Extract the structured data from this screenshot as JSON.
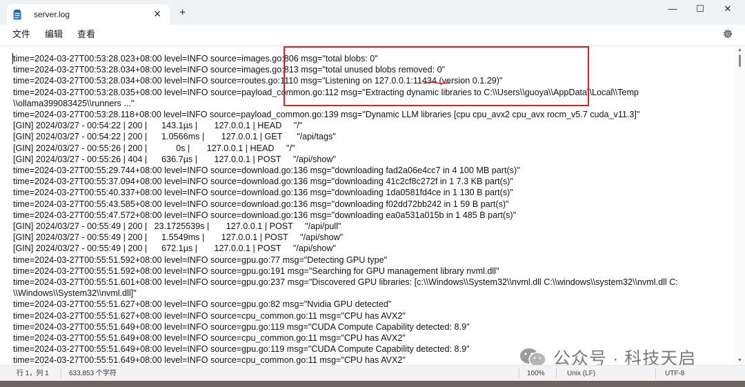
{
  "window": {
    "tab_title": "server.log",
    "tab_close": "✕",
    "new_tab": "+",
    "minimize": "—",
    "maximize": "☐",
    "close": "✕"
  },
  "menu": {
    "file": "文件",
    "edit": "编辑",
    "view": "查看"
  },
  "log_lines": [
    "time=2024-03-27T00:53:28.023+08:00 level=INFO source=images.go:806 msg=\"total blobs: 0\"",
    "time=2024-03-27T00:53:28.034+08:00 level=INFO source=images.go:813 msg=\"total unused blobs removed: 0\"",
    "time=2024-03-27T00:53:28.034+08:00 level=INFO source=routes.go:1110 msg=\"Listening on 127.0.0.1:11434 (version 0.1.29)\"",
    "time=2024-03-27T00:53:28.035+08:00 level=INFO source=payload_common.go:112 msg=\"Extracting dynamic libraries to C:\\\\Users\\\\guoya\\\\AppData\\\\Local\\\\Temp",
    "\\\\ollama399083425\\\\runners ...\"",
    "time=2024-03-27T00:53:28.118+08:00 level=INFO source=payload_common.go:139 msg=\"Dynamic LLM libraries [cpu cpu_avx2 cpu_avx rocm_v5.7 cuda_v11.3]\"",
    "[GIN] 2024/03/27 - 00:54:22 | 200 |      143.1µs |       127.0.0.1 | HEAD     \"/\"",
    "[GIN] 2024/03/27 - 00:54:22 | 200 |      1.0566ms |       127.0.0.1 | GET      \"/api/tags\"",
    "[GIN] 2024/03/27 - 00:55:26 | 200 |            0s |       127.0.0.1 | HEAD     \"/\"",
    "[GIN] 2024/03/27 - 00:55:26 | 404 |      636.7µs |       127.0.0.1 | POST     \"/api/show\"",
    "time=2024-03-27T00:55:29.744+08:00 level=INFO source=download.go:136 msg=\"downloading fad2a06e4cc7 in 4 100 MB part(s)\"",
    "time=2024-03-27T00:55:37.094+08:00 level=INFO source=download.go:136 msg=\"downloading 41c2cf8c272f in 1 7.3 KB part(s)\"",
    "time=2024-03-27T00:55:40.337+08:00 level=INFO source=download.go:136 msg=\"downloading 1da0581fd4ce in 1 130 B part(s)\"",
    "time=2024-03-27T00:55:43.585+08:00 level=INFO source=download.go:136 msg=\"downloading f02dd72bb242 in 1 59 B part(s)\"",
    "time=2024-03-27T00:55:47.572+08:00 level=INFO source=download.go:136 msg=\"downloading ea0a531a015b in 1 485 B part(s)\"",
    "[GIN] 2024/03/27 - 00:55:49 | 200 |   23.1725539s |       127.0.0.1 | POST     \"/api/pull\"",
    "[GIN] 2024/03/27 - 00:55:49 | 200 |      1.5549ms |       127.0.0.1 | POST     \"/api/show\"",
    "[GIN] 2024/03/27 - 00:55:49 | 200 |      672.1µs |       127.0.0.1 | POST     \"/api/show\"",
    "time=2024-03-27T00:55:51.592+08:00 level=INFO source=gpu.go:77 msg=\"Detecting GPU type\"",
    "time=2024-03-27T00:55:51.592+08:00 level=INFO source=gpu.go:191 msg=\"Searching for GPU management library nvml.dll\"",
    "time=2024-03-27T00:55:51.601+08:00 level=INFO source=gpu.go:237 msg=\"Discovered GPU libraries: [c:\\\\Windows\\\\System32\\\\nvml.dll C:\\\\windows\\\\system32\\\\nvml.dll C:",
    "\\\\Windows\\\\System32\\\\nvml.dll]\"",
    "time=2024-03-27T00:55:51.627+08:00 level=INFO source=gpu.go:82 msg=\"Nvidia GPU detected\"",
    "time=2024-03-27T00:55:51.627+08:00 level=INFO source=cpu_common.go:11 msg=\"CPU has AVX2\"",
    "time=2024-03-27T00:55:51.649+08:00 level=INFO source=gpu.go:119 msg=\"CUDA Compute Capability detected: 8.9\"",
    "time=2024-03-27T00:55:51.649+08:00 level=INFO source=cpu_common.go:11 msg=\"CPU has AVX2\"",
    "time=2024-03-27T00:55:51.649+08:00 level=INFO source=gpu.go:119 msg=\"CUDA Compute Capability detected: 8.9\"",
    "time=2024-03-27T00:55:51.649+08:00 level=INFO source=cpu_common.go:11 msg=\"CPU has AVX2\""
  ],
  "status": {
    "position": "行 1，列 1",
    "char_count": "633,853 个字符",
    "zoom": "100%",
    "line_ending": "Unix (LF)",
    "encoding": "UTF-8"
  },
  "watermark": {
    "text": "公众号 · 科技天启"
  },
  "colors": {
    "annotation": "#e02020",
    "titlebar": "#eff2f4",
    "statusbar": "#f3f3f3"
  },
  "icons": {
    "file": "notepad-file-icon",
    "settings": "gear-icon",
    "watermark": "wechat-logo-icon"
  }
}
